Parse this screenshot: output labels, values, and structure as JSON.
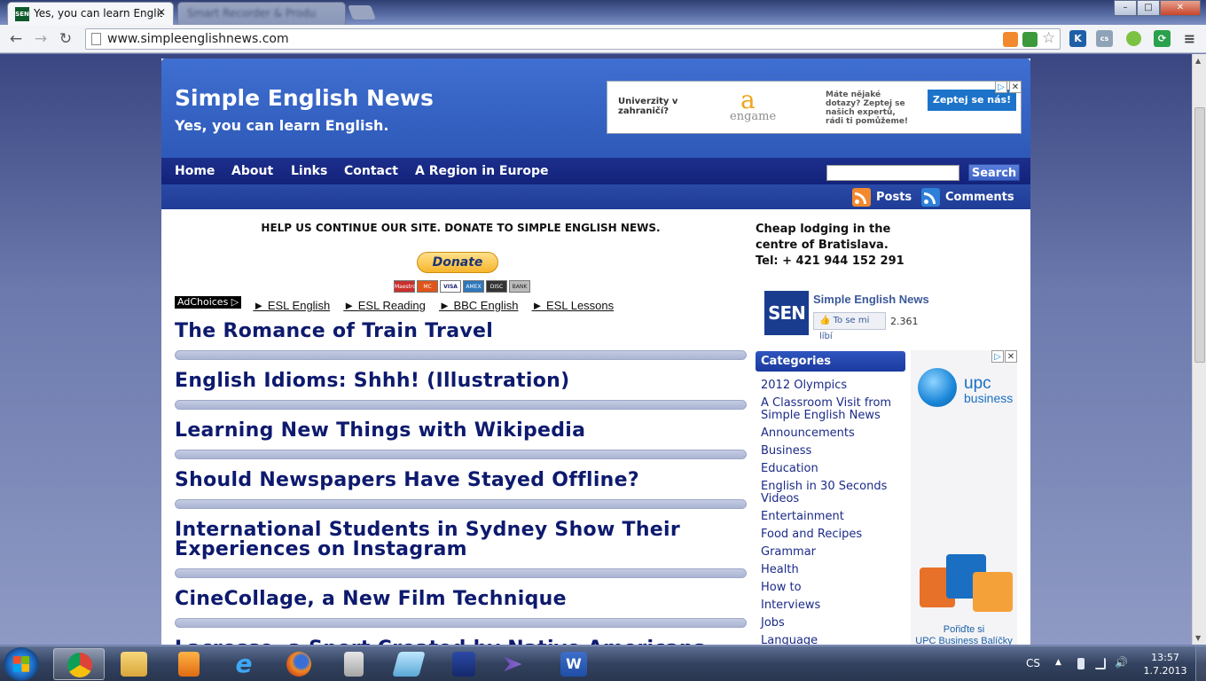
{
  "browser": {
    "active_tab_title": "Yes, you can learn English",
    "active_tab_favicon": "SEN",
    "inactive_tab_title": "Smart Recorder & Products",
    "url": "www.simpleenglishnews.com",
    "window_controls": [
      "–",
      "□",
      "✕"
    ]
  },
  "site": {
    "title": "Simple English News",
    "tagline": "Yes, you can learn English."
  },
  "ad_top": {
    "left_text": "Univerzity v zahraničí?",
    "logo_letter": "a",
    "logo_text": "engame",
    "middle_text": "Máte nějaké dotazy? Zeptej se našich expertů, rádi ti pomůžeme!",
    "cta": "Zeptej se nás!"
  },
  "nav": {
    "items": [
      "Home",
      "About",
      "Links",
      "Contact",
      "A Region in Europe"
    ],
    "search_value": "",
    "search_button": "Search"
  },
  "feeds": {
    "posts": "Posts",
    "comments": "Comments"
  },
  "donate": {
    "heading": "HELP US CONTINUE OUR SITE. DONATE TO SIMPLE ENGLISH NEWS.",
    "button": "Donate",
    "cards": [
      "Maestro",
      "MC",
      "VISA",
      "AMEX",
      "DISC",
      "BANK"
    ]
  },
  "ad_links": {
    "adchoices": "AdChoices ▷",
    "links": [
      "► ESL English",
      "► ESL Reading",
      "► BBC English",
      "► ESL Lessons"
    ]
  },
  "posts": [
    "The Romance of Train Travel",
    "English Idioms: Shhh! (Illustration)",
    "Learning New Things with Wikipedia",
    "Should Newspapers Have Stayed Offline?",
    "International Students in Sydney Show Their Experiences on Instagram",
    "CineCollage, a New Film Technique",
    "Lacrosse, a Sport Created by Native Americans"
  ],
  "sidebar": {
    "lodging_lines": [
      "Cheap lodging in the",
      "centre of Bratislava.",
      "Tel: + 421 944 152 291"
    ],
    "fb": {
      "logo": "SEN",
      "name": "Simple English News",
      "like": "To se mi líbí",
      "count": "2.361"
    },
    "categories_title": "Categories",
    "categories": [
      "2012 Olympics",
      "A Classroom Visit from Simple English News",
      "Announcements",
      "Business",
      "Education",
      "English in 30 Seconds Videos",
      "Entertainment",
      "Food and Recipes",
      "Grammar",
      "Health",
      "How to",
      "Interviews",
      "Jobs",
      "Language"
    ]
  },
  "ad_side": {
    "brand": "upc",
    "brand_sub": "business",
    "cta_line1": "Pořiďte si",
    "cta_line2": "UPC Business Balíčky"
  },
  "taskbar": {
    "lang": "CS",
    "time": "13:57",
    "date": "1.7.2013"
  }
}
